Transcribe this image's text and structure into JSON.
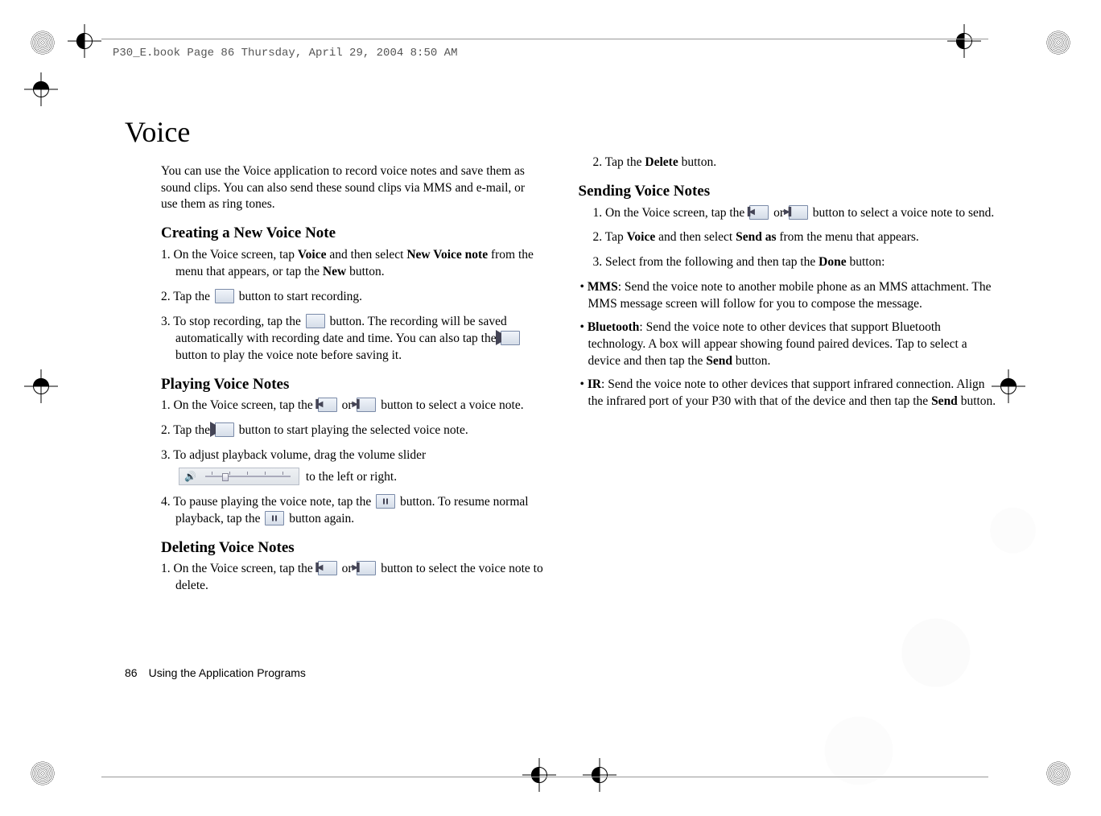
{
  "header_line": "P30_E.book  Page 86  Thursday, April 29, 2004  8:50 AM",
  "title": "Voice",
  "intro": "You can use the Voice application to record voice notes and save them as sound clips. You can also send these sound clips via MMS and e-mail, or use them as ring tones.",
  "sec_create": "Creating a New Voice Note",
  "create_1a": "1. On the Voice screen, tap ",
  "create_1_voice": "Voice",
  "create_1b": " and then select ",
  "create_1_nvn": "New Voice note",
  "create_1c": " from the menu that appears, or tap the ",
  "create_1_new": "New",
  "create_1d": " button.",
  "create_2a": "2. Tap the ",
  "create_2b": " button to start recording.",
  "create_3a": "3. To stop recording, tap the ",
  "create_3b": " button. The recording will be saved automatically with recording date and time. You can also tap the ",
  "create_3c": " button to play the voice note before saving it.",
  "sec_play": "Playing Voice Notes",
  "play_1a": "1. On the Voice screen, tap the ",
  "play_1_or": " or ",
  "play_1b": " button to select a voice note.",
  "play_2a": "2. Tap the ",
  "play_2b": " button to start playing the selected voice note.",
  "play_3a": "3. To adjust playback volume, drag the volume slider ",
  "play_3b": " to the left or right.",
  "play_4a": "4. To pause playing the voice note, tap the ",
  "play_4b": " button. To resume normal playback, tap the ",
  "play_4c": " button again.",
  "sec_delete": "Deleting Voice Notes",
  "del_1a": "1. On the Voice screen, tap the ",
  "del_1_or": " or ",
  "del_1b": " button to select the voice note to delete.",
  "del_2a": "2. Tap the ",
  "del_2_bold": "Delete",
  "del_2b": " button.",
  "sec_send": "Sending Voice Notes",
  "send_1a": "1. On the Voice screen, tap the ",
  "send_1_or": " or ",
  "send_1b": " button to select a voice note to send.",
  "send_2a": "2. Tap ",
  "send_2_voice": "Voice",
  "send_2b": " and then select ",
  "send_2_sendas": "Send as",
  "send_2c": " from the menu that appears.",
  "send_3a": "3. Select from the following and then tap the ",
  "send_3_done": "Done",
  "send_3b": " button:",
  "bul_mms_label": "MMS",
  "bul_mms_text": ": Send the voice note to another mobile phone as an MMS attachment. The MMS message screen will follow for you to compose the message.",
  "bul_bt_label": "Bluetooth",
  "bul_bt_text": ": Send the voice note to other devices that support Bluetooth technology. A box will appear showing found paired devices. Tap to select a device and then tap the ",
  "bul_bt_send": "Send",
  "bul_bt_text2": " button.",
  "bul_ir_label": "IR",
  "bul_ir_text": ": Send the voice note to other devices that support infrared connection. Align the infrared port of your P30 with that of the device and then tap the ",
  "bul_ir_send": "Send",
  "bul_ir_text2": " button.",
  "footer_page": "86",
  "footer_section": "Using the Application Programs"
}
